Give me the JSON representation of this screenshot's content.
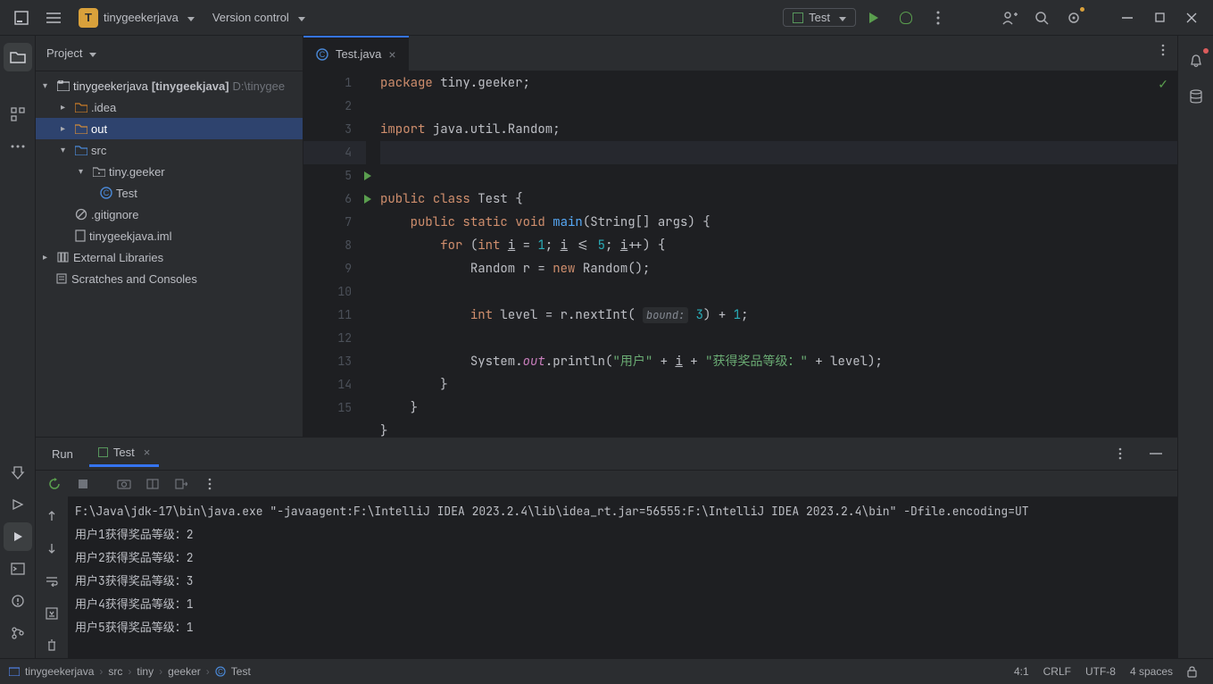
{
  "titlebar": {
    "project_name": "tinygeekerjava",
    "vcs_label": "Version control",
    "runconf_label": "Test"
  },
  "project_pane": {
    "header": "Project",
    "root_name": "tinygeekerjava",
    "root_bold": "[tinygeekjava]",
    "root_path": "D:\\tinygee",
    "idea": ".idea",
    "out": "out",
    "src": "src",
    "pkg": "tiny.geeker",
    "test": "Test",
    "gitignore": ".gitignore",
    "iml": "tinygeekjava.iml",
    "ext_lib": "External Libraries",
    "scratches": "Scratches and Consoles"
  },
  "editor": {
    "tab_label": "Test.java",
    "lines": [
      "1",
      "2",
      "3",
      "4",
      "5",
      "6",
      "7",
      "8",
      "9",
      "10",
      "11",
      "12",
      "13",
      "14",
      "15"
    ],
    "code": {
      "l1_kw": "package",
      "l1_rest": " tiny.geeker;",
      "l3_kw": "import",
      "l3_rest": " java.util.Random;",
      "l5_public": "public ",
      "l5_class": "class ",
      "l5_name": "Test",
      "l5_brace": " {",
      "l6_indent": "    ",
      "l6_public": "public ",
      "l6_static": "static ",
      "l6_void": "void ",
      "l6_main": "main",
      "l6_args": "(String[] args) {",
      "l7_indent": "        ",
      "l7_for": "for ",
      "l7_p1": "(",
      "l7_int": "int ",
      "l7_i1": "i",
      "l7_eq": " = ",
      "l7_n1": "1",
      "l7_semi1": "; ",
      "l7_i2": "i",
      "l7_le": " <= ",
      "l7_n5": "5",
      "l7_semi2": "; ",
      "l7_i3": "i",
      "l7_pp": "++) {",
      "l8_indent": "            ",
      "l8_r": "Random r = ",
      "l8_new": "new ",
      "l8_rand": "Random();",
      "l10_indent": "            ",
      "l10_int": "int ",
      "l10_rest": "level = r.nextInt( ",
      "l10_hint": "bound:",
      "l10_n3": "3",
      "l10_p": ") + ",
      "l10_n1": "1",
      "l10_semi": ";",
      "l12_indent": "            ",
      "l12_sys": "System.",
      "l12_out": "out",
      "l12_print": ".println(",
      "l12_s1": "\"用户\"",
      "l12_plus1": " + ",
      "l12_i": "i",
      "l12_plus2": " + ",
      "l12_s2": "\"获得奖品等级：\"",
      "l12_plus3": " + level);",
      "l13": "        }",
      "l14": "    }",
      "l15": "}"
    }
  },
  "run": {
    "header": "Run",
    "tab": "Test",
    "console": {
      "cmd": "F:\\Java\\jdk-17\\bin\\java.exe \"-javaagent:F:\\IntelliJ IDEA 2023.2.4\\lib\\idea_rt.jar=56555:F:\\IntelliJ IDEA 2023.2.4\\bin\" -Dfile.encoding=UT",
      "o1": "用户1获得奖品等级：2",
      "o2": "用户2获得奖品等级：2",
      "o3": "用户3获得奖品等级：3",
      "o4": "用户4获得奖品等级：1",
      "o5": "用户5获得奖品等级：1"
    }
  },
  "breadcrumb": {
    "c1": "tinygeekerjava",
    "c2": "src",
    "c3": "tiny",
    "c4": "geeker",
    "c5": "Test"
  },
  "status": {
    "caret": "4:1",
    "linesep": "CRLF",
    "encoding": "UTF-8",
    "indent": "4 spaces"
  }
}
